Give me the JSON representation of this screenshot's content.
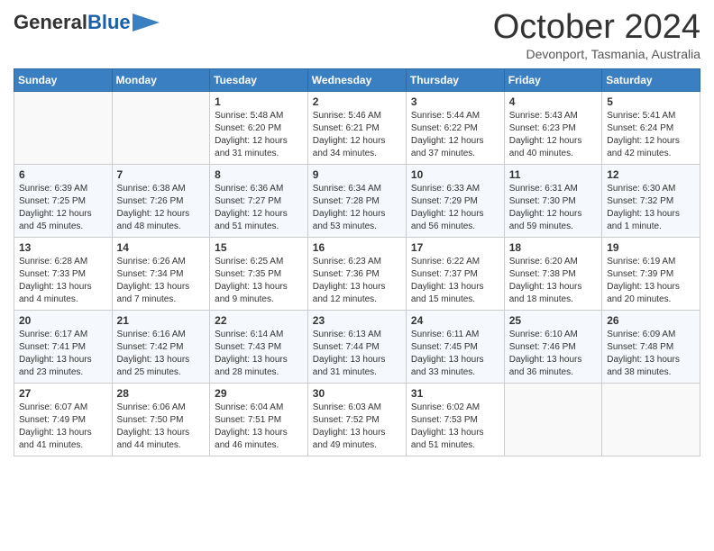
{
  "header": {
    "logo_line1": "General",
    "logo_line2": "Blue",
    "month": "October 2024",
    "location": "Devonport, Tasmania, Australia"
  },
  "days_of_week": [
    "Sunday",
    "Monday",
    "Tuesday",
    "Wednesday",
    "Thursday",
    "Friday",
    "Saturday"
  ],
  "weeks": [
    [
      {
        "day": "",
        "info": ""
      },
      {
        "day": "",
        "info": ""
      },
      {
        "day": "1",
        "info": "Sunrise: 5:48 AM\nSunset: 6:20 PM\nDaylight: 12 hours and 31 minutes."
      },
      {
        "day": "2",
        "info": "Sunrise: 5:46 AM\nSunset: 6:21 PM\nDaylight: 12 hours and 34 minutes."
      },
      {
        "day": "3",
        "info": "Sunrise: 5:44 AM\nSunset: 6:22 PM\nDaylight: 12 hours and 37 minutes."
      },
      {
        "day": "4",
        "info": "Sunrise: 5:43 AM\nSunset: 6:23 PM\nDaylight: 12 hours and 40 minutes."
      },
      {
        "day": "5",
        "info": "Sunrise: 5:41 AM\nSunset: 6:24 PM\nDaylight: 12 hours and 42 minutes."
      }
    ],
    [
      {
        "day": "6",
        "info": "Sunrise: 6:39 AM\nSunset: 7:25 PM\nDaylight: 12 hours and 45 minutes."
      },
      {
        "day": "7",
        "info": "Sunrise: 6:38 AM\nSunset: 7:26 PM\nDaylight: 12 hours and 48 minutes."
      },
      {
        "day": "8",
        "info": "Sunrise: 6:36 AM\nSunset: 7:27 PM\nDaylight: 12 hours and 51 minutes."
      },
      {
        "day": "9",
        "info": "Sunrise: 6:34 AM\nSunset: 7:28 PM\nDaylight: 12 hours and 53 minutes."
      },
      {
        "day": "10",
        "info": "Sunrise: 6:33 AM\nSunset: 7:29 PM\nDaylight: 12 hours and 56 minutes."
      },
      {
        "day": "11",
        "info": "Sunrise: 6:31 AM\nSunset: 7:30 PM\nDaylight: 12 hours and 59 minutes."
      },
      {
        "day": "12",
        "info": "Sunrise: 6:30 AM\nSunset: 7:32 PM\nDaylight: 13 hours and 1 minute."
      }
    ],
    [
      {
        "day": "13",
        "info": "Sunrise: 6:28 AM\nSunset: 7:33 PM\nDaylight: 13 hours and 4 minutes."
      },
      {
        "day": "14",
        "info": "Sunrise: 6:26 AM\nSunset: 7:34 PM\nDaylight: 13 hours and 7 minutes."
      },
      {
        "day": "15",
        "info": "Sunrise: 6:25 AM\nSunset: 7:35 PM\nDaylight: 13 hours and 9 minutes."
      },
      {
        "day": "16",
        "info": "Sunrise: 6:23 AM\nSunset: 7:36 PM\nDaylight: 13 hours and 12 minutes."
      },
      {
        "day": "17",
        "info": "Sunrise: 6:22 AM\nSunset: 7:37 PM\nDaylight: 13 hours and 15 minutes."
      },
      {
        "day": "18",
        "info": "Sunrise: 6:20 AM\nSunset: 7:38 PM\nDaylight: 13 hours and 18 minutes."
      },
      {
        "day": "19",
        "info": "Sunrise: 6:19 AM\nSunset: 7:39 PM\nDaylight: 13 hours and 20 minutes."
      }
    ],
    [
      {
        "day": "20",
        "info": "Sunrise: 6:17 AM\nSunset: 7:41 PM\nDaylight: 13 hours and 23 minutes."
      },
      {
        "day": "21",
        "info": "Sunrise: 6:16 AM\nSunset: 7:42 PM\nDaylight: 13 hours and 25 minutes."
      },
      {
        "day": "22",
        "info": "Sunrise: 6:14 AM\nSunset: 7:43 PM\nDaylight: 13 hours and 28 minutes."
      },
      {
        "day": "23",
        "info": "Sunrise: 6:13 AM\nSunset: 7:44 PM\nDaylight: 13 hours and 31 minutes."
      },
      {
        "day": "24",
        "info": "Sunrise: 6:11 AM\nSunset: 7:45 PM\nDaylight: 13 hours and 33 minutes."
      },
      {
        "day": "25",
        "info": "Sunrise: 6:10 AM\nSunset: 7:46 PM\nDaylight: 13 hours and 36 minutes."
      },
      {
        "day": "26",
        "info": "Sunrise: 6:09 AM\nSunset: 7:48 PM\nDaylight: 13 hours and 38 minutes."
      }
    ],
    [
      {
        "day": "27",
        "info": "Sunrise: 6:07 AM\nSunset: 7:49 PM\nDaylight: 13 hours and 41 minutes."
      },
      {
        "day": "28",
        "info": "Sunrise: 6:06 AM\nSunset: 7:50 PM\nDaylight: 13 hours and 44 minutes."
      },
      {
        "day": "29",
        "info": "Sunrise: 6:04 AM\nSunset: 7:51 PM\nDaylight: 13 hours and 46 minutes."
      },
      {
        "day": "30",
        "info": "Sunrise: 6:03 AM\nSunset: 7:52 PM\nDaylight: 13 hours and 49 minutes."
      },
      {
        "day": "31",
        "info": "Sunrise: 6:02 AM\nSunset: 7:53 PM\nDaylight: 13 hours and 51 minutes."
      },
      {
        "day": "",
        "info": ""
      },
      {
        "day": "",
        "info": ""
      }
    ]
  ]
}
